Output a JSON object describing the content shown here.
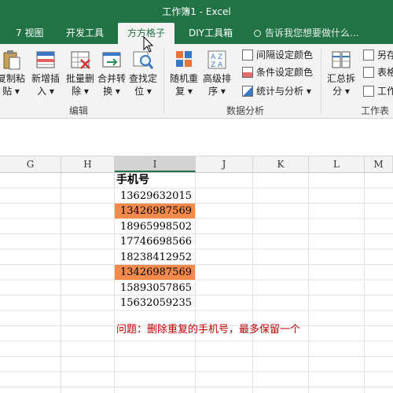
{
  "window": {
    "title": "工作簿1 - Excel"
  },
  "tabs": [
    {
      "label": "7 视图",
      "active": false
    },
    {
      "label": "开发工具",
      "active": false
    },
    {
      "label": "方方格子",
      "active": true
    },
    {
      "label": "DIY工具箱",
      "active": false
    }
  ],
  "tell_me": {
    "text": "告诉我您想要做什么..."
  },
  "ribbon": {
    "groups": {
      "edit": {
        "label": "编辑",
        "buttons": [
          {
            "label1": "复制粘",
            "label2": "贴 ▾"
          },
          {
            "label1": "新增插",
            "label2": "入 ▾"
          },
          {
            "label1": "批量删",
            "label2": "除 ▾"
          },
          {
            "label1": "合并转",
            "label2": "换 ▾"
          },
          {
            "label1": "查找定",
            "label2": "位 ▾"
          }
        ]
      },
      "analysis": {
        "label": "数据分析",
        "buttons": [
          {
            "label1": "随机重",
            "label2": "复 ▾"
          },
          {
            "label1": "高级排",
            "label2": "序 ▾"
          }
        ],
        "small_buttons": [
          {
            "label": "间隔设定颜色"
          },
          {
            "label": "条件设定颜色"
          },
          {
            "label": "统计与分析 ▾"
          }
        ]
      },
      "worksheet": {
        "label": "工作表",
        "buttons": [
          {
            "label1": "汇总拆",
            "label2": "分 ▾"
          }
        ],
        "small_buttons": [
          {
            "label": "另存"
          },
          {
            "label": "表格"
          },
          {
            "label": "工作"
          }
        ]
      }
    }
  },
  "sheet": {
    "columns": [
      "G",
      "H",
      "I",
      "J",
      "K",
      "L",
      "M"
    ],
    "selected_column": "I",
    "header": "手机号",
    "phones": [
      {
        "value": "13629632015",
        "duplicate": false
      },
      {
        "value": "13426987569",
        "duplicate": true
      },
      {
        "value": "18965998502",
        "duplicate": false
      },
      {
        "value": "17746698566",
        "duplicate": false
      },
      {
        "value": "18238412952",
        "duplicate": false
      },
      {
        "value": "13426987569",
        "duplicate": true
      },
      {
        "value": "15893057865",
        "duplicate": false
      },
      {
        "value": "15632059235",
        "duplicate": false
      }
    ],
    "note": "问题：删除重复的手机号，最多保留一个"
  },
  "colors": {
    "brand": "#217346",
    "duplicate_fill": "#f48a4c",
    "note_text": "#c00000"
  }
}
